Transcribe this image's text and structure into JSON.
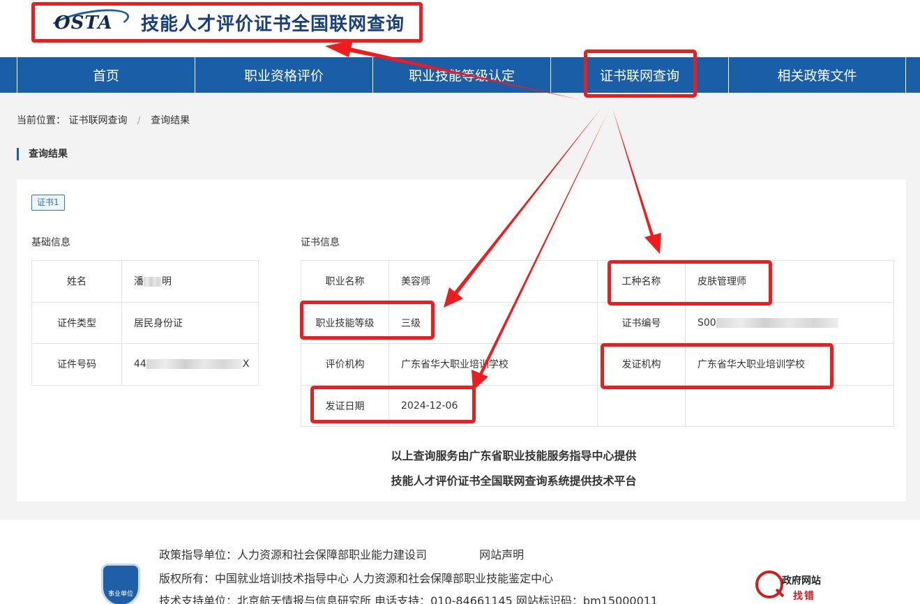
{
  "header": {
    "logo_text": "OSTA",
    "site_title": "技能人才评价证书全国联网查询"
  },
  "nav": {
    "items": [
      {
        "label": "首页"
      },
      {
        "label": "职业资格评价"
      },
      {
        "label": "职业技能等级认定"
      },
      {
        "label": "证书联网查询"
      },
      {
        "label": "相关政策文件"
      }
    ]
  },
  "breadcrumb": {
    "prefix": "当前位置：",
    "crumb1": "证书联网查询",
    "separator": "/",
    "crumb2": "查询结果"
  },
  "section_title": "查询结果",
  "result": {
    "cert_tab": "证书1",
    "basic_title": "基础信息",
    "cert_title": "证书信息",
    "basic": {
      "name_label": "姓名",
      "name_value_start": "潘",
      "name_value_end": "明",
      "id_type_label": "证件类型",
      "id_type_value": "居民身份证",
      "id_no_label": "证件号码",
      "id_no_start": "44",
      "id_no_end": "X"
    },
    "cert": {
      "occupation_label": "职业名称",
      "occupation_value": "美容师",
      "job_type_label": "工种名称",
      "job_type_value": "皮肤管理师",
      "level_label": "职业技能等级",
      "level_value": "三级",
      "cert_no_label": "证书编号",
      "cert_no_start": "S00",
      "eval_org_label": "评价机构",
      "eval_org_value": "广东省华大职业培训学校",
      "issuer_label": "发证机构",
      "issuer_value": "广东省华大职业培训学校",
      "issue_date_label": "发证日期",
      "issue_date_value": "2024-12-06"
    },
    "provider_line1": "以上查询服务由广东省职业技能服务指导中心提供",
    "provider_line2": "技能人才评价证书全国联网查询系统提供技术平台"
  },
  "footer": {
    "policy_line": "政策指导单位：人力资源和社会保障部职业能力建设司",
    "statement_link": "网站声明",
    "copyright_line": "版权所有：中国就业培训技术指导中心   人力资源和社会保障部职业技能鉴定中心",
    "support_line": "技术支持单位：北京航天情报与信息研究所   电话支持：010-84661145   网站标识码：bm15000011",
    "badge_text": "事业单位",
    "gov_logo_line1": "政府网站",
    "gov_logo_line2": "找错"
  },
  "colors": {
    "nav_blue": "#1a5ea8",
    "annotation_red": "#ee1c1c",
    "tag_blue": "#2b7ac0"
  }
}
